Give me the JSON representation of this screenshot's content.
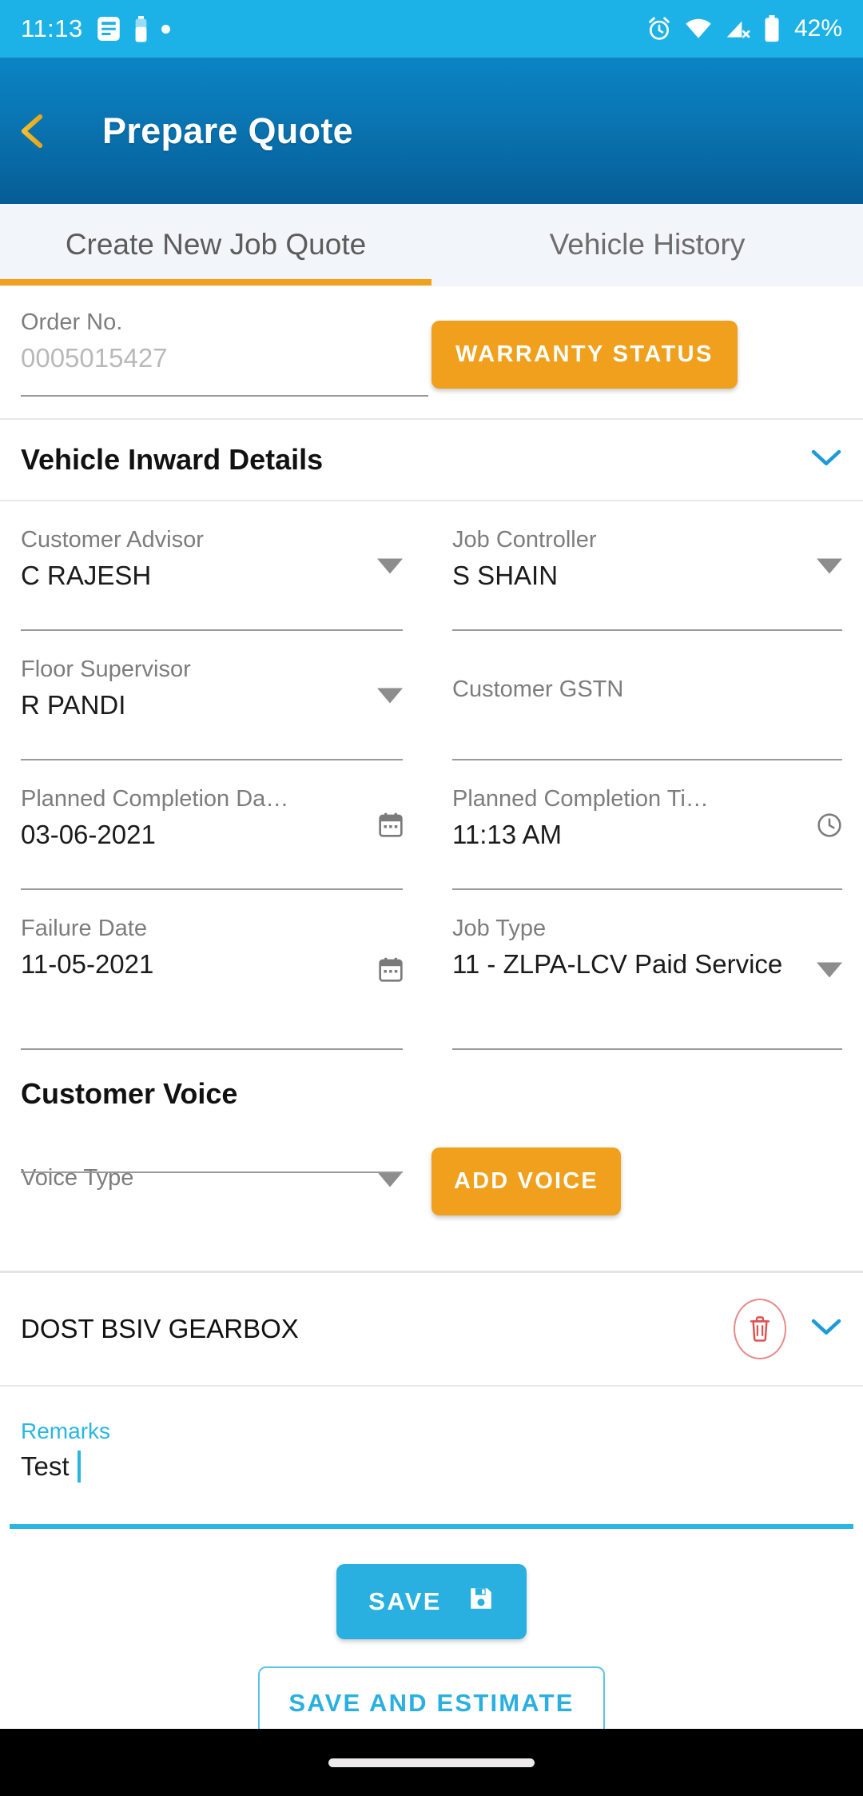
{
  "status_bar": {
    "time": "11:13",
    "battery_percent": "42%",
    "icons": [
      "notes-icon",
      "battery-small-icon",
      "dot-indicator-icon",
      "alarm-icon",
      "wifi-icon",
      "signal-off-icon",
      "battery-icon"
    ]
  },
  "app_bar": {
    "title": "Prepare Quote",
    "back_icon": "back-arrow-icon"
  },
  "tabs": [
    {
      "label": "Create New Job Quote",
      "active": true
    },
    {
      "label": "Vehicle History",
      "active": false
    }
  ],
  "order": {
    "label": "Order No.",
    "value": "0005015427",
    "warranty_button": "WARRANTY STATUS"
  },
  "vehicle_inward": {
    "section_title": "Vehicle Inward Details",
    "expand_icon": "chevron-down-icon",
    "fields": [
      {
        "label": "Customer Advisor",
        "value": "C RAJESH",
        "trailing": "caret-down-icon"
      },
      {
        "label": "Job Controller",
        "value": "S SHAIN",
        "trailing": "caret-down-icon"
      },
      {
        "label": "Floor Supervisor",
        "value": "R PANDI",
        "trailing": "caret-down-icon"
      },
      {
        "label": "Customer GSTN",
        "value": "",
        "trailing": ""
      },
      {
        "label": "Planned Completion Da…",
        "value": "03-06-2021",
        "trailing": "calendar-icon"
      },
      {
        "label": "Planned Completion Ti…",
        "value": "11:13 AM",
        "trailing": "clock-icon"
      },
      {
        "label": "Failure Date",
        "value": "11-05-2021",
        "trailing": "calendar-icon"
      },
      {
        "label": "Job Type",
        "value": "11 - ZLPA-LCV Paid Service",
        "trailing": "caret-down-icon"
      }
    ]
  },
  "customer_voice": {
    "section_title": "Customer Voice",
    "voice_type_label": "Voice Type",
    "voice_type_value": "",
    "add_voice_button": "ADD VOICE",
    "items": [
      {
        "title": "DOST BSIV GEARBOX",
        "delete_icon": "trash-icon",
        "expand_icon": "chevron-down-icon",
        "remarks_label": "Remarks",
        "remarks_value": "Test"
      }
    ]
  },
  "actions": {
    "save_label": "SAVE",
    "save_icon": "save-floppy-icon",
    "save_estimate_label": "SAVE AND ESTIMATE"
  },
  "colors": {
    "status_bar": "#1cb2e8",
    "app_bar_top": "#0b84c4",
    "app_bar_bottom": "#065d95",
    "accent_orange": "#f0a01c",
    "accent_cyan": "#29b0e0",
    "tab_indicator": "#f2a11b",
    "delete_red": "#e05252"
  }
}
